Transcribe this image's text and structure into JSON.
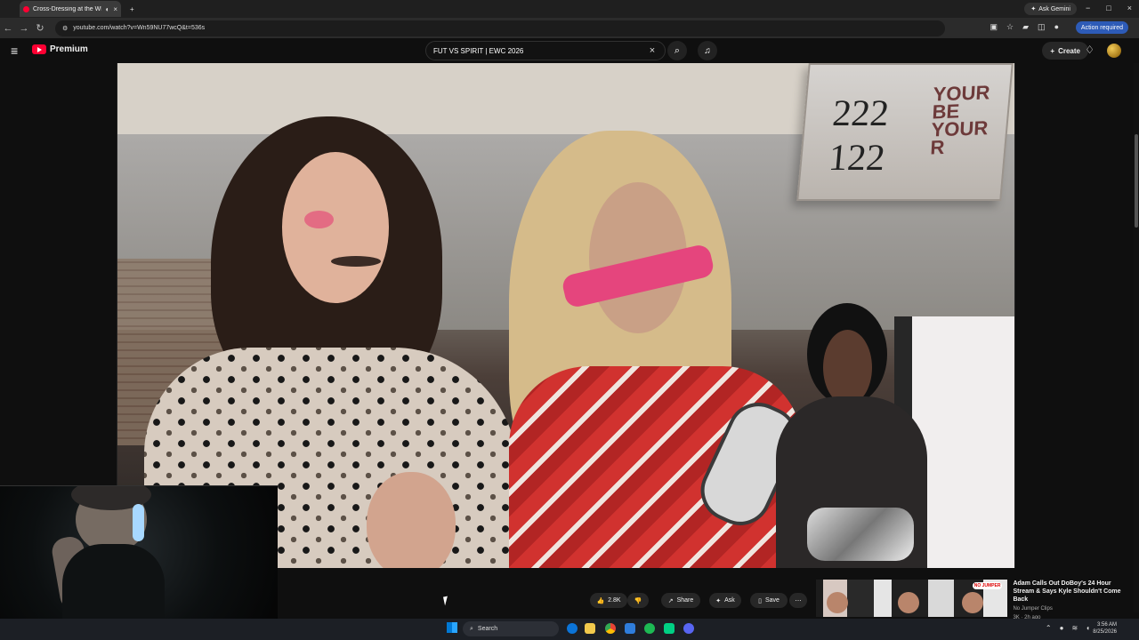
{
  "browser": {
    "tab_title": "Cross-Dressing at the WN",
    "new_tab_symbol": "+",
    "ask_gemini": "Ask Gemini",
    "url": "youtube.com/watch?v=Wn59NU77wcQ&t=536s",
    "action_required": "Action required"
  },
  "youtube": {
    "logo_text": "Premium",
    "search_value": "FUT VS SPIRIT | EWC 2026",
    "create_label": "Create",
    "actions": {
      "like_count": "2.8K",
      "share_label": "Share",
      "ask_label": "Ask",
      "save_label": "Save"
    },
    "recommendation": {
      "title": "Adam Calls Out DoBoy's 24 Hour Stream & Says Kyle Shouldn't Come Back",
      "channel": "No Jumper Clips",
      "meta": "3K · 2h ago",
      "thumbnail_badge": "NO JUMPER"
    }
  },
  "video_scene": {
    "sign_numbers": [
      "222",
      "122"
    ],
    "sign_text": "YOUR BE YOUR R"
  },
  "taskbar": {
    "search_placeholder": "Search",
    "time": "3:56 AM",
    "date": "8/25/2026"
  },
  "colors": {
    "youtube_red": "#ff0033",
    "accent_blue": "#2d5bb7",
    "dark_bg": "#0f0f0f"
  }
}
